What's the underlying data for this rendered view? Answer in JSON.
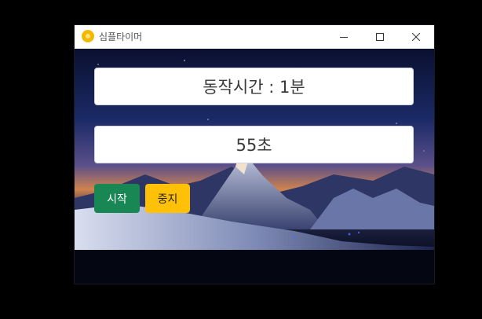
{
  "window": {
    "title": "심플타이머"
  },
  "timer": {
    "duration_text": "동작시간 : 1분",
    "remaining_text": "55초"
  },
  "buttons": {
    "start_label": "시작",
    "stop_label": "중지"
  },
  "colors": {
    "start_button": "#198754",
    "stop_button": "#ffc107",
    "app_icon": "#f5b800"
  },
  "icons": {
    "app": "app-timer-icon",
    "minimize": "minimize-icon",
    "maximize": "maximize-icon",
    "close": "close-icon"
  }
}
